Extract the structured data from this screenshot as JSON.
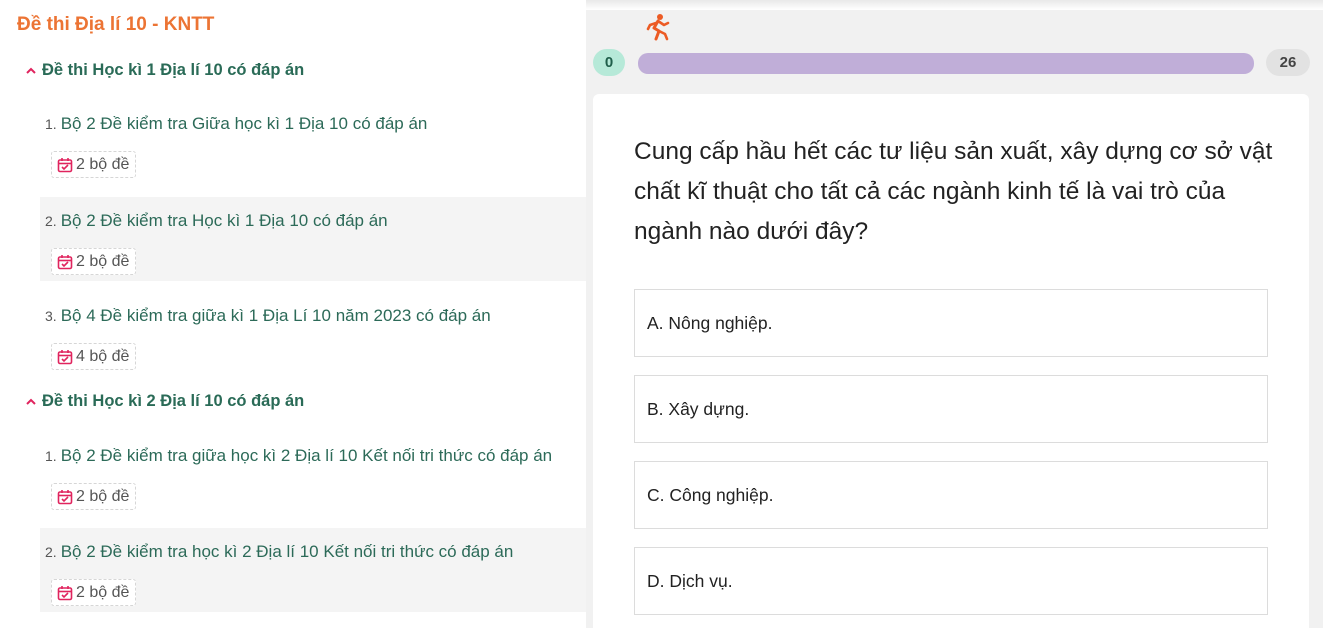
{
  "sidebar": {
    "title": "Đề thi Địa lí 10 - KNTT",
    "sections": [
      {
        "label": "Đề thi Học kì 1 Địa lí 10 có đáp án",
        "items": [
          {
            "num": "1.",
            "label": "Bộ 2 Đề kiểm tra Giữa học kì 1 Địa 10 có đáp án",
            "badge": "2 bộ đề"
          },
          {
            "num": "2.",
            "label": "Bộ 2 Đề kiểm tra Học kì 1 Địa 10 có đáp án",
            "badge": "2 bộ đề"
          },
          {
            "num": "3.",
            "label": "Bộ 4 Đề kiểm tra giữa kì 1 Địa Lí 10 năm 2023 có đáp án",
            "badge": "4 bộ đề"
          }
        ]
      },
      {
        "label": "Đề thi Học kì 2 Địa lí 10 có đáp án",
        "items": [
          {
            "num": "1.",
            "label": "Bộ 2 Đề kiểm tra giữa học kì 2 Địa lí 10 Kết nối tri thức có đáp án",
            "badge": "2 bộ đề"
          },
          {
            "num": "2.",
            "label": "Bộ 2 Đề kiểm tra học kì 2 Địa lí 10 Kết nối tri thức có đáp án",
            "badge": "2 bộ đề"
          }
        ]
      }
    ]
  },
  "quiz": {
    "progress_start": "0",
    "progress_end": "26",
    "progress_fraction": 1.0,
    "question": "Cung cấp hầu hết các tư liệu sản xuất, xây dựng cơ sở vật chất kĩ thuật cho tất cả các ngành kinh tế là vai trò của ngành nào dưới đây?",
    "options": [
      "A. Nông nghiệp.",
      "B. Xây dựng.",
      "C. Công nghiệp.",
      "D. Dịch vụ."
    ]
  },
  "colors": {
    "title_orange": "#ec7434",
    "link_green": "#2c6a58",
    "progress_purple": "#c0aed8",
    "pill_green": "#b6e9d8",
    "calendar_red": "#e0245e"
  },
  "icons": {
    "section_toggle": "chevron-up-icon",
    "badge": "calendar-check-icon",
    "progress": "running-person-icon"
  }
}
